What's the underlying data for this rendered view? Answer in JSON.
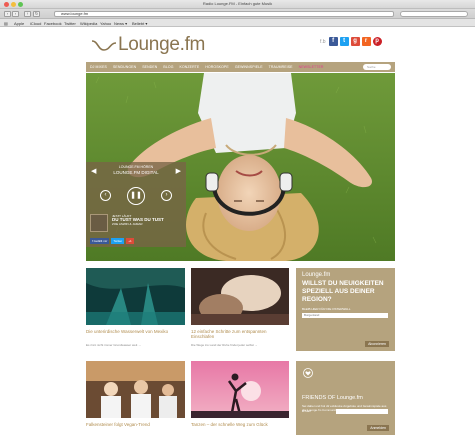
{
  "browser": {
    "window_title": "Radio Lounge.FM - Einfach gute Musik",
    "address": "www.lounge.fm",
    "bookmarks": [
      "Apple",
      "iCloud",
      "Facebook",
      "Twitter",
      "Wikipedia",
      "Yahoo",
      "News ▾",
      "Beliebt ▾"
    ]
  },
  "site": {
    "logo": "Lounge.fm",
    "social_label": "Lounge.fm",
    "nav": [
      "DJ MIXES",
      "SENDUNGEN",
      "SENDEN",
      "BLOG",
      "KONZERTE",
      "HOROSKOPE",
      "GEWINNSPIELE",
      "TRAUMREISE"
    ],
    "nav_highlight": "NEWSLETTER",
    "nav_search": "Suche"
  },
  "player": {
    "channel_label": "LOUNGE.FM HÖREN",
    "channel": "LOUNGE.FM DIGITAL",
    "now_label": "JETZT LÄUFT",
    "now_title": "DU TUST WAS DU TUST",
    "now_artist": "ZOE ASWIN & JAMAR",
    "share": [
      "f Gefällt mir",
      "Twitter",
      "+1"
    ]
  },
  "articles": [
    {
      "title": "Die unterirdische Wasserwelt von Mexiko",
      "sub": "Es rinnt nicht immer Grundwasser weit  →"
    },
    {
      "title": "12 einfache Schritte zum entspannten Einschlafen",
      "sub": "Die Wege ins Land der Ruhe findet jeder selbst  →"
    },
    {
      "title": "Falkensteiner folgt Vegan-Trend",
      "sub": ""
    },
    {
      "title": "Tanzen – der schnelle Weg zum Glück",
      "sub": ""
    }
  ],
  "sidebox": {
    "logo": "Lounge.fm",
    "heading": "WILLST DU NEUIGKEITEN SPEZIELL AUS DEINER REGION?",
    "sub": "BLEIB HIER FÜR DIE OSTERWALL",
    "select": "Burgenland",
    "button": "Abonnieren"
  },
  "friends": {
    "heading": "FRIENDS OF Lounge.fm",
    "text": "Sei dabei und hol dir exklusive Angebote und Gewinnspiele aus der Lounge.fm Community.",
    "field_label": "E-Mail",
    "button": "Anmelden"
  },
  "colors": {
    "brand": "#b5a37e",
    "brand_dark": "#8a7550",
    "highlight": "#e03a8c"
  }
}
